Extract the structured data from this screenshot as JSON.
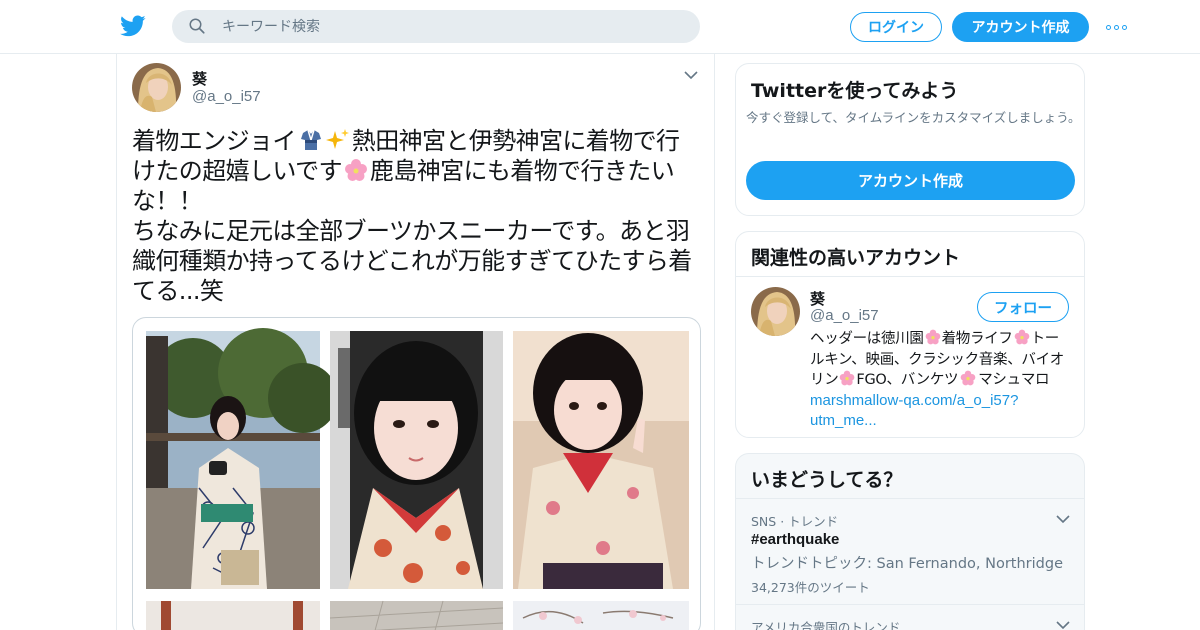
{
  "header": {
    "search_placeholder": "キーワード検索",
    "login_label": "ログイン",
    "signup_label": "アカウント作成"
  },
  "tweet": {
    "display_name": "葵",
    "handle": "@a_o_i57",
    "text_parts": {
      "p1": "着物エンジョイ",
      "p2": "熱田神宮と伊勢神宮に着物で行けたの超嬉しいです",
      "p3": "鹿島神宮にも着物で行きたいな！！\nちなみに足元は全部ブーツかスニーカーです。あと羽織何種類か持ってるけどこれが万能すぎてひたすら着てる...笑"
    },
    "emoji": [
      "kimono-emoji",
      "sparkles-emoji",
      "cherry-blossom-emoji"
    ]
  },
  "signup_card": {
    "title": "Twitterを使ってみよう",
    "subtitle": "今すぐ登録して、タイムラインをカスタマイズしましょう。",
    "button_label": "アカウント作成"
  },
  "related": {
    "title": "関連性の高いアカウント",
    "name": "葵",
    "handle": "@a_o_i57",
    "follow_label": "フォロー",
    "bio_parts": {
      "b1": "ヘッダーは徳川園",
      "b2": "着物ライフ",
      "b3": "トールキン、映画、クラシック音楽、バイオリン",
      "b4": "FGO、バンケツ",
      "b5": "マシュマロ",
      "link": "marshmallow-qa.com/a_o_i57?utm_me..."
    }
  },
  "trends": {
    "title": "いまどうしてる？",
    "items": [
      {
        "context": "SNS · トレンド",
        "name": "#earthquake",
        "description": "トレンドトピック: San Fernando, Northridge",
        "count": "34,273件のツイート"
      },
      {
        "context": "アメリカ合衆国のトレンド"
      }
    ]
  },
  "colors": {
    "accent": "#1da1f2",
    "link": "#1b95e0",
    "muted": "#657786",
    "border": "#e6ecf0"
  }
}
